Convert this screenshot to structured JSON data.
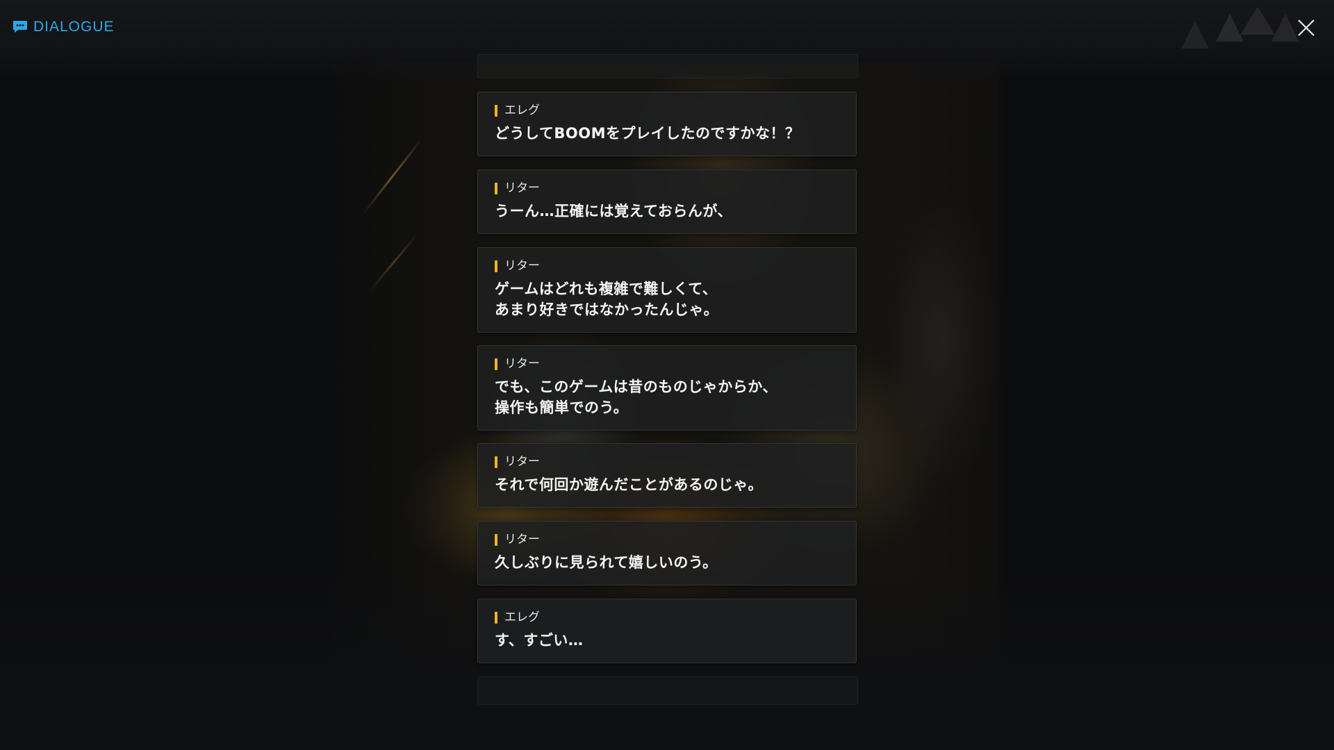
{
  "header": {
    "title": "DIALOGUE",
    "icon": "chat-bubble-icon",
    "accent_color": "#2ea7e8"
  },
  "close_button": {
    "icon": "close-icon"
  },
  "speaker_bar_color": "#f2b71d",
  "dialogue": [
    {
      "speaker": "エレグ",
      "lines": [
        "どうしてBOOMをプレイしたのですかな！？"
      ]
    },
    {
      "speaker": "リター",
      "lines": [
        "うーん…正確には覚えておらんが、"
      ]
    },
    {
      "speaker": "リター",
      "lines": [
        "ゲームはどれも複雑で難しくて、",
        "あまり好きではなかったんじゃ。"
      ]
    },
    {
      "speaker": "リター",
      "lines": [
        "でも、このゲームは昔のものじゃからか、",
        "操作も簡単でのう。"
      ]
    },
    {
      "speaker": "リター",
      "lines": [
        "それで何回か遊んだことがあるのじゃ。"
      ]
    },
    {
      "speaker": "リター",
      "lines": [
        "久しぶりに見られて嬉しいのう。"
      ]
    },
    {
      "speaker": "エレグ",
      "lines": [
        "す、すごい…"
      ]
    }
  ]
}
